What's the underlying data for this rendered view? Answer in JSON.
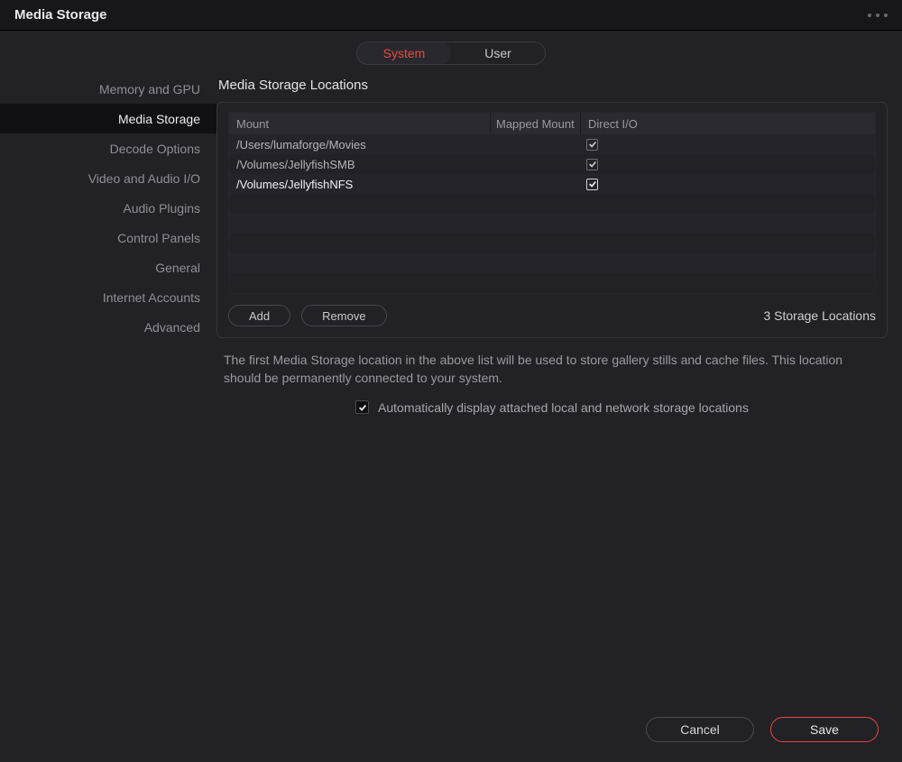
{
  "window": {
    "title": "Media Storage"
  },
  "topTabs": {
    "system": "System",
    "user": "User",
    "active": "system"
  },
  "sidebar": {
    "items": [
      {
        "label": "Memory and GPU"
      },
      {
        "label": "Media Storage"
      },
      {
        "label": "Decode Options"
      },
      {
        "label": "Video and Audio I/O"
      },
      {
        "label": "Audio Plugins"
      },
      {
        "label": "Control Panels"
      },
      {
        "label": "General"
      },
      {
        "label": "Internet Accounts"
      },
      {
        "label": "Advanced"
      }
    ],
    "selectedIndex": 1
  },
  "section": {
    "title": "Media Storage Locations",
    "columns": {
      "mount": "Mount",
      "mapped": "Mapped Mount",
      "direct": "Direct I/O"
    },
    "rows": [
      {
        "mount": "/Users/lumaforge/Movies",
        "mapped": "",
        "directIO": true
      },
      {
        "mount": "/Volumes/JellyfishSMB",
        "mapped": "",
        "directIO": true
      },
      {
        "mount": "/Volumes/JellyfishNFS",
        "mapped": "",
        "directIO": true
      }
    ],
    "selectedRow": 2,
    "emptyRows": 5,
    "buttons": {
      "add": "Add",
      "remove": "Remove"
    },
    "countLabel": "3 Storage Locations",
    "helpText": "The first Media Storage location in the above list will be used to store gallery stills and cache files. This location should be permanently connected to your system.",
    "autoDisplay": {
      "checked": true,
      "label": "Automatically display attached local and network storage locations"
    }
  },
  "footer": {
    "cancel": "Cancel",
    "save": "Save"
  },
  "colors": {
    "accent": "#e64b3c"
  }
}
